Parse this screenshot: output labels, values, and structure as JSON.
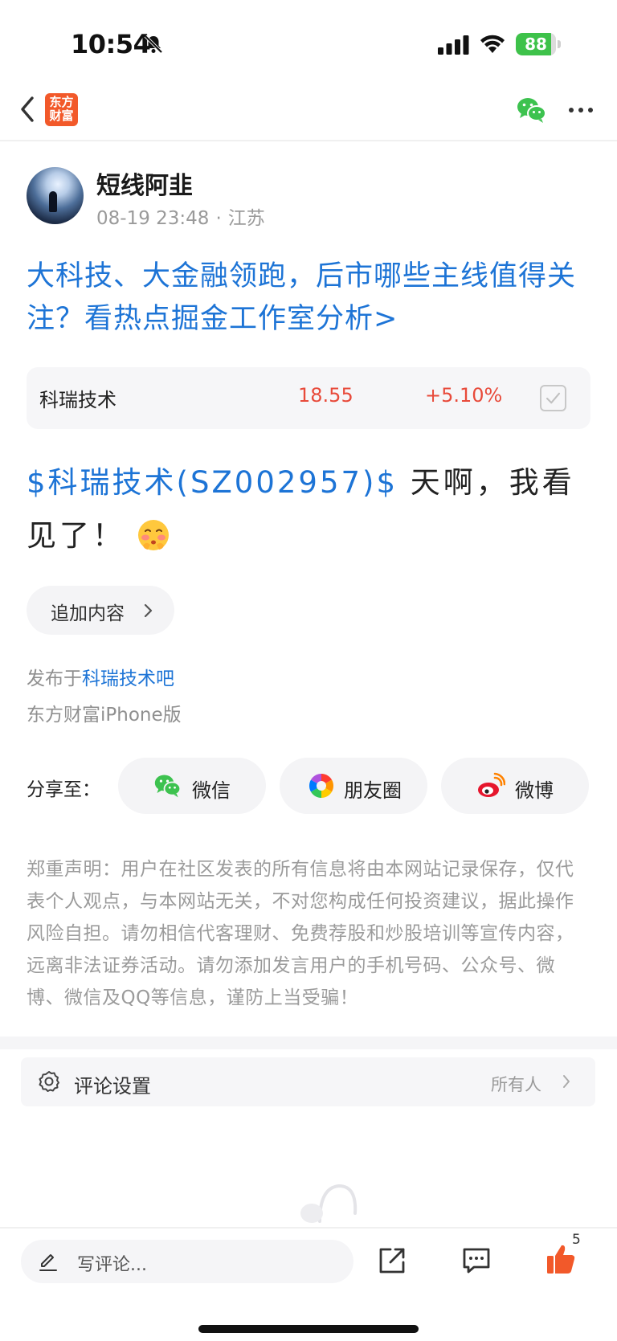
{
  "status_bar": {
    "time": "10:54",
    "battery": "88",
    "battery_level": 0.88,
    "icons": [
      "bell-off-icon",
      "signal-icon",
      "wifi-icon",
      "battery-icon"
    ]
  },
  "nav": {
    "logo_line1": "东方",
    "logo_line2": "财富",
    "icons": [
      "back-icon",
      "wechat-icon",
      "more-icon"
    ]
  },
  "author": {
    "name": "短线阿韭",
    "datetime": "08-19 23:48",
    "separator": "·",
    "location": "江苏"
  },
  "headline": "大科技、大金融领跑，后市哪些主线值得关注？看热点掘金工作室分析>",
  "stock": {
    "name": "科瑞技术",
    "price": "18.55",
    "change": "+5.10%",
    "color": "#e84a3a"
  },
  "post": {
    "mention": "$科瑞技术(SZ002957)$",
    "text": " 天啊，我看见了！"
  },
  "add_content": {
    "label": "追加内容"
  },
  "published": {
    "prefix": "发布于",
    "forum": "科瑞技术吧"
  },
  "platform": "东方财富iPhone版",
  "share": {
    "label": "分享至：",
    "targets": [
      {
        "label": "微信",
        "icon": "wechat-icon"
      },
      {
        "label": "朋友圈",
        "icon": "moments-icon"
      },
      {
        "label": "微博",
        "icon": "weibo-icon"
      }
    ]
  },
  "disclaimer": "郑重声明：用户在社区发表的所有信息将由本网站记录保存，仅代表个人观点，与本网站无关，不对您构成任何投资建议，据此操作风险自担。请勿相信代客理财、免费荐股和炒股培训等宣传内容，远离非法证券活动。请勿添加发言用户的手机号码、公众号、微博、微信及QQ等信息，谨防上当受骗！",
  "comment_settings": {
    "label": "评论设置",
    "value": "所有人"
  },
  "bottom_bar": {
    "placeholder": "写评论...",
    "like_count": "5",
    "accent": "#f2592a"
  }
}
